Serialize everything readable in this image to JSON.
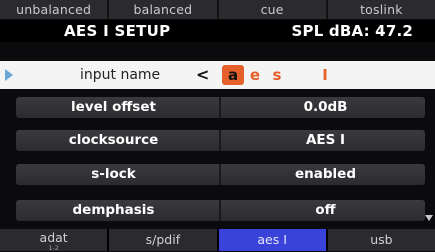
{
  "top_tabs": [
    "unbalanced",
    "balanced",
    "cue",
    "toslink"
  ],
  "header": {
    "title": "AES I SETUP",
    "spl": "SPL dBA: 47.2"
  },
  "input_name": {
    "label": "input name",
    "cursor_symbol": "<",
    "chars": [
      "a",
      "e",
      "s",
      "",
      "I"
    ],
    "selected_index": 0
  },
  "params": [
    {
      "name": "level offset",
      "value": "0.0dB"
    },
    {
      "name": "clocksource",
      "value": "AES I"
    },
    {
      "name": "s-lock",
      "value": "enabled"
    },
    {
      "name": "demphasis",
      "value": "off"
    }
  ],
  "bottom_tabs": [
    {
      "label": "adat",
      "sub": "1-2"
    },
    {
      "label": "s/pdif",
      "sub": ""
    },
    {
      "label": "aes I",
      "sub": "",
      "active": true
    },
    {
      "label": "usb",
      "sub": ""
    }
  ],
  "colors": {
    "accent": "#e5602a",
    "active_tab": "#3a43d9"
  }
}
